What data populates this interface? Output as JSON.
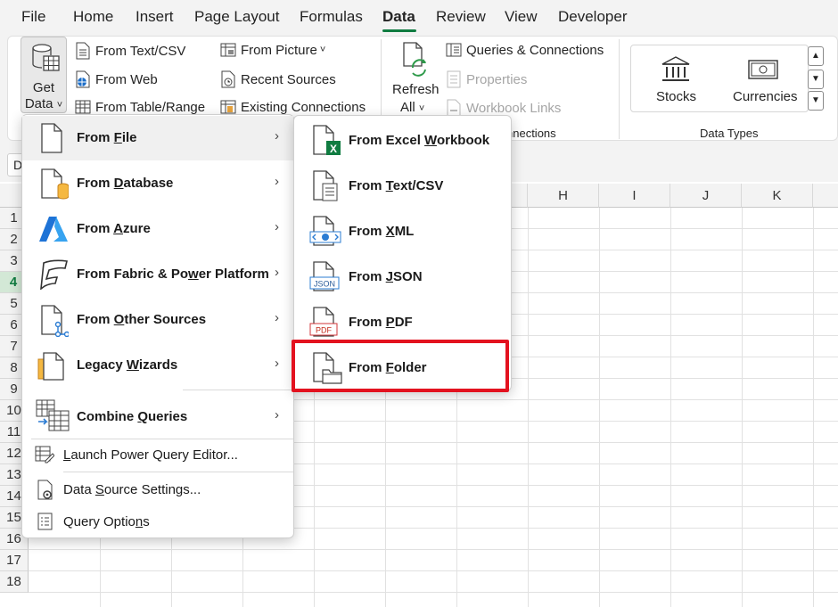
{
  "tabs": [
    "File",
    "Home",
    "Insert",
    "Page Layout",
    "Formulas",
    "Data",
    "Review",
    "View",
    "Developer"
  ],
  "active_tab": "Data",
  "accent_color": "#107c41",
  "ribbon": {
    "get_data": {
      "line1": "Get",
      "line2": "Data",
      "caret": "˅"
    },
    "col1": [
      "From Text/CSV",
      "From Web",
      "From Table/Range"
    ],
    "col2": [
      "From Picture",
      "Recent Sources",
      "Existing Connections"
    ],
    "col2_caret": "˅",
    "refresh": {
      "line1": "Refresh",
      "line2": "All",
      "caret": "˅"
    },
    "col3": [
      "Queries & Connections",
      "Properties",
      "Workbook Links"
    ],
    "connections_label": "nnections",
    "data_types": [
      "Stocks",
      "Currencies"
    ],
    "data_types_label": "Data Types"
  },
  "namebox": "D",
  "columns": [
    "H",
    "I",
    "J",
    "K"
  ],
  "rows": [
    "1",
    "2",
    "3",
    "4",
    "5",
    "6",
    "7",
    "8",
    "9",
    "10",
    "11",
    "12",
    "13",
    "14",
    "15",
    "16",
    "17",
    "18"
  ],
  "selected_row": "4",
  "get_data_menu": {
    "items": [
      {
        "pre": "From ",
        "u": "F",
        "post": "ile",
        "icon": "file-icon"
      },
      {
        "pre": "From ",
        "u": "D",
        "post": "atabase",
        "icon": "database-icon"
      },
      {
        "pre": "From ",
        "u": "A",
        "post": "zure",
        "icon": "azure-icon"
      },
      {
        "pre": "From Fabric & Po",
        "u": "w",
        "post": "er Platform",
        "icon": "fabric-icon"
      },
      {
        "pre": "From ",
        "u": "O",
        "post": "ther Sources",
        "icon": "other-sources-icon"
      },
      {
        "pre": "Legacy ",
        "u": "W",
        "post": "izards",
        "icon": "legacy-wizards-icon"
      },
      {
        "pre": "Combine ",
        "u": "Q",
        "post": "ueries",
        "icon": "combine-queries-icon"
      }
    ],
    "chevron": "›",
    "plain_items": [
      {
        "pre": "",
        "u": "L",
        "post": "aunch Power Query Editor..."
      },
      {
        "pre": "Data ",
        "u": "S",
        "post": "ource Settings..."
      },
      {
        "pre": "Query Optio",
        "u": "n",
        "post": "s"
      }
    ]
  },
  "from_file_menu": {
    "items": [
      {
        "pre": "From Excel ",
        "u": "W",
        "post": "orkbook",
        "badge": "X"
      },
      {
        "pre": "From ",
        "u": "T",
        "post": "ext/CSV",
        "badge": ""
      },
      {
        "pre": "From ",
        "u": "X",
        "post": "ML",
        "badge": "</>"
      },
      {
        "pre": "From ",
        "u": "J",
        "post": "SON",
        "badge": "JSON"
      },
      {
        "pre": "From ",
        "u": "P",
        "post": "DF",
        "badge": "PDF"
      },
      {
        "pre": "From ",
        "u": "F",
        "post": "older",
        "badge": ""
      }
    ]
  }
}
